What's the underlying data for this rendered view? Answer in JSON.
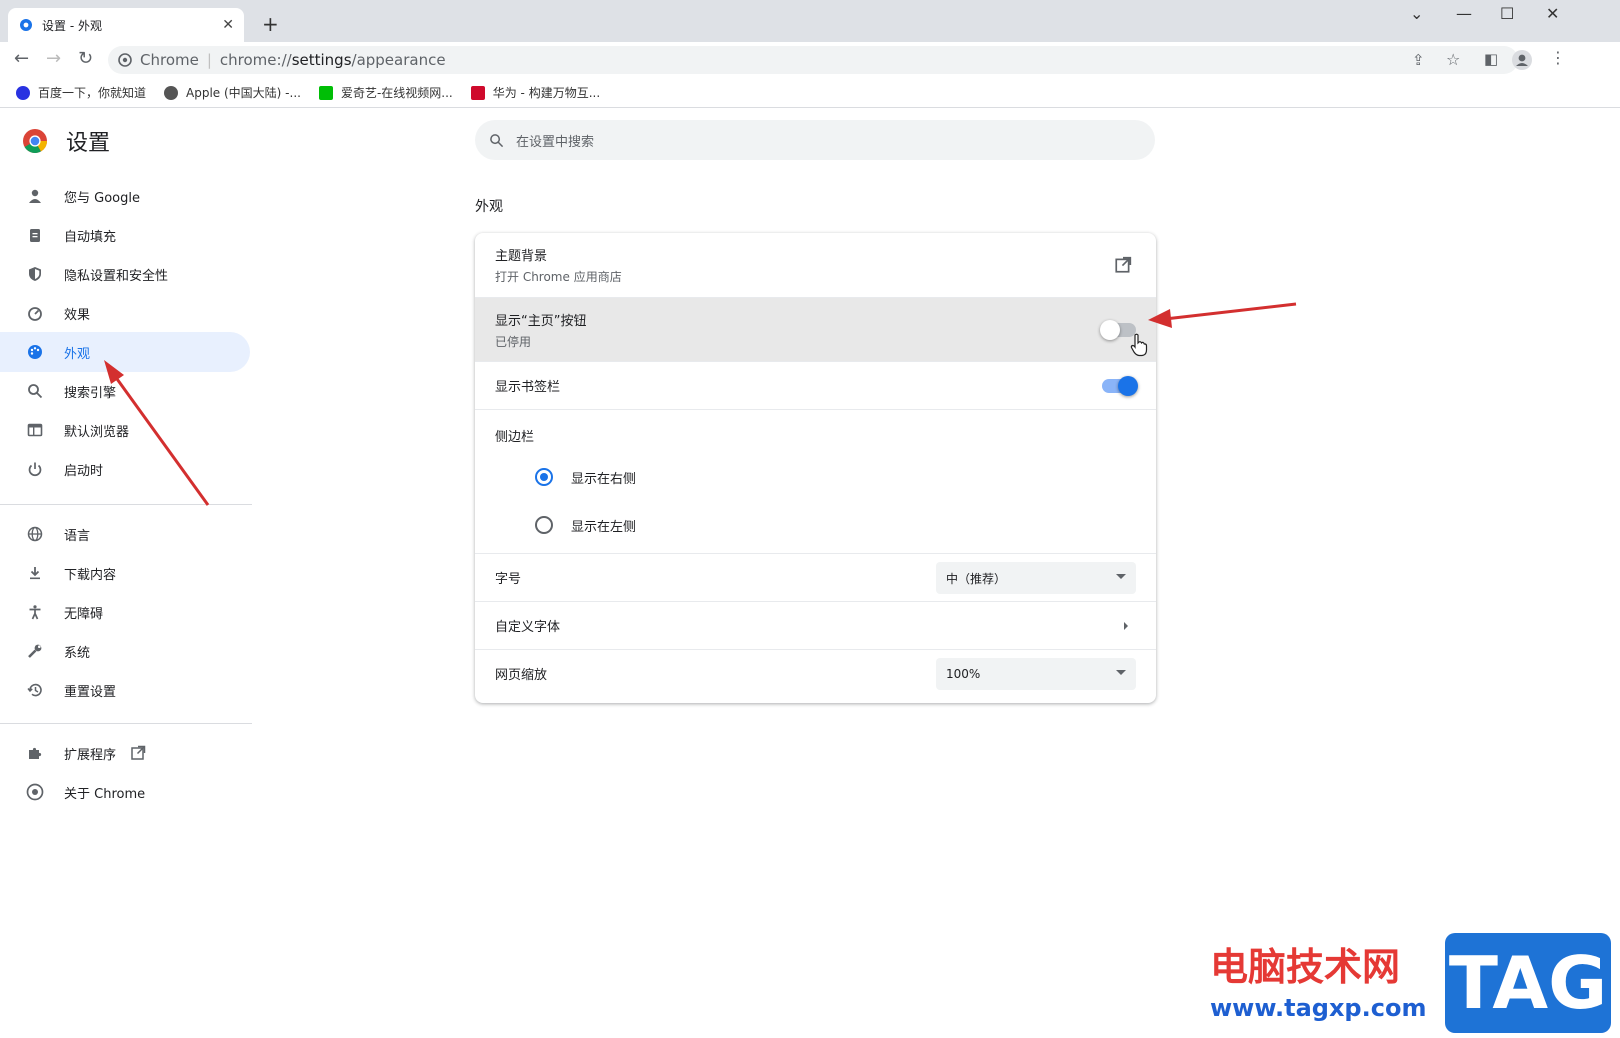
{
  "tab": {
    "title": "设置 - 外观",
    "close": "✕",
    "new": "+"
  },
  "window": {
    "minimize": "—",
    "maximize": "☐",
    "close": "✕",
    "dropdown": "⌄"
  },
  "address": {
    "site": "Chrome",
    "separator": "|",
    "prefix": "chrome://",
    "path": "settings",
    "rest": "/appearance"
  },
  "bookmarks": [
    {
      "label": "百度一下，你就知道",
      "color": "#2932e1"
    },
    {
      "label": "Apple (中国大陆) -...",
      "color": "#555555"
    },
    {
      "label": "爱奇艺-在线视频网...",
      "color": "#00be06"
    },
    {
      "label": "华为 - 构建万物互...",
      "color": "#cf0a2c"
    }
  ],
  "brand": {
    "title": "设置"
  },
  "search": {
    "placeholder": "在设置中搜索"
  },
  "sidebar": {
    "items": [
      {
        "label": "您与 Google"
      },
      {
        "label": "自动填充"
      },
      {
        "label": "隐私设置和安全性"
      },
      {
        "label": "效果"
      },
      {
        "label": "外观"
      },
      {
        "label": "搜索引擎"
      },
      {
        "label": "默认浏览器"
      },
      {
        "label": "启动时"
      },
      {
        "label": "语言"
      },
      {
        "label": "下载内容"
      },
      {
        "label": "无障碍"
      },
      {
        "label": "系统"
      },
      {
        "label": "重置设置"
      },
      {
        "label": "扩展程序"
      },
      {
        "label": "关于 Chrome"
      }
    ]
  },
  "main": {
    "section_title": "外观",
    "theme": {
      "label": "主题背景",
      "sub": "打开 Chrome 应用商店"
    },
    "home_button": {
      "label": "显示“主页”按钮",
      "sub": "已停用",
      "enabled": false
    },
    "bookmarks_bar": {
      "label": "显示书签栏",
      "enabled": true
    },
    "side_panel": {
      "label": "侧边栏",
      "options": [
        "显示在右侧",
        "显示在左侧"
      ],
      "selected": 0
    },
    "font_size": {
      "label": "字号",
      "value": "中（推荐）"
    },
    "custom_fonts": {
      "label": "自定义字体"
    },
    "zoom": {
      "label": "网页缩放",
      "value": "100%"
    }
  },
  "watermark": {
    "cn": "电脑技术网",
    "url": "www.tagxp.com",
    "tag": "TAG"
  },
  "colors": {
    "accent": "#1a73e8",
    "annotation": "#d32f2f"
  }
}
